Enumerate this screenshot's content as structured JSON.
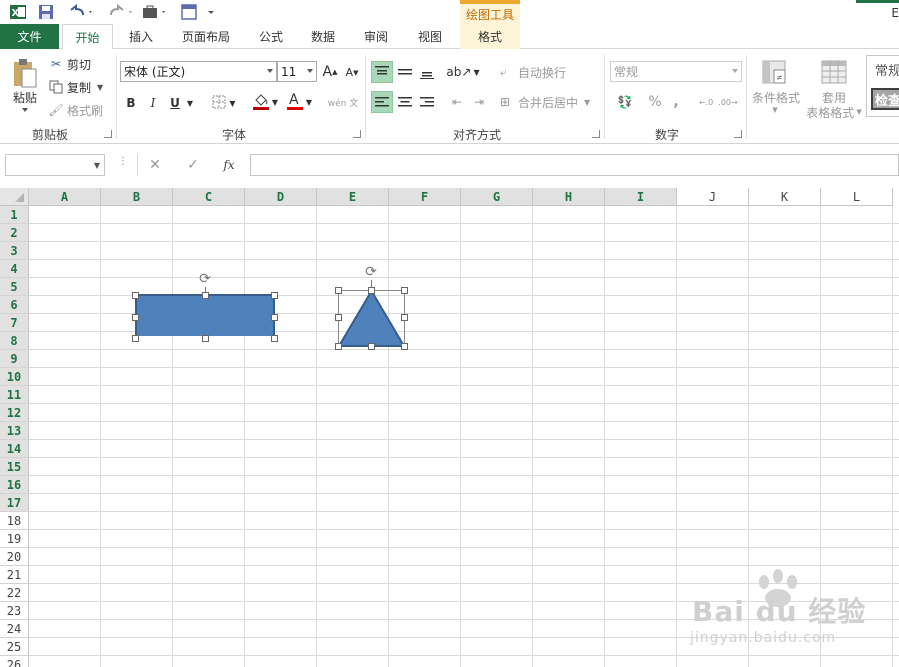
{
  "titlebar": {
    "contextual_header": "绘图工具",
    "title_edge_char": "E",
    "icons": [
      "excel-logo-icon",
      "save-icon",
      "undo-icon",
      "redo-icon",
      "briefcase-icon",
      "window-icon"
    ]
  },
  "tabs": {
    "file": "文件",
    "home": "开始",
    "insert": "插入",
    "page_layout": "页面布局",
    "formulas": "公式",
    "data": "数据",
    "review": "审阅",
    "view": "视图",
    "format": "格式"
  },
  "ribbon": {
    "clipboard": {
      "label": "剪贴板",
      "paste": "粘贴",
      "cut": "剪切",
      "copy": "复制",
      "format_painter": "格式刷"
    },
    "font": {
      "label": "字体",
      "font_name": "宋体 (正文)",
      "font_size": "11",
      "bold": "B",
      "italic": "I",
      "underline": "U",
      "grow": "A",
      "shrink": "A",
      "phonetic": "wén 文"
    },
    "alignment": {
      "label": "对齐方式",
      "wrap_text": "自动换行",
      "merge_center": "合并后居中"
    },
    "number": {
      "label": "数字",
      "format": "常规",
      "percent": "%",
      "comma": ","
    },
    "styles": {
      "conditional": "条件格式",
      "table_line1": "套用",
      "table_line2": "表格格式",
      "style_normal": "常规",
      "style_check": "检查"
    }
  },
  "formula_bar": {
    "fx": "fx",
    "cancel": "✕",
    "enter": "✓"
  },
  "columns": [
    "A",
    "B",
    "C",
    "D",
    "E",
    "F",
    "G",
    "H",
    "I",
    "J",
    "K",
    "L"
  ],
  "rows": [
    "1",
    "2",
    "3",
    "4",
    "5",
    "6",
    "7",
    "8",
    "9",
    "10",
    "11",
    "12",
    "13",
    "14",
    "15",
    "16",
    "17",
    "18",
    "19",
    "20",
    "21",
    "22",
    "23",
    "24",
    "25",
    "26"
  ],
  "selected_columns": 9,
  "selected_rows": 17,
  "shapes": {
    "rectangle_color": "#4f81bd",
    "triangle_color": "#4f81bd",
    "outline_color": "#385d8a"
  },
  "watermark": {
    "brand": "Bai du 经验",
    "url": "jingyan.baidu.com"
  },
  "colors": {
    "accent": "#217346",
    "contextual": "#f0a830"
  }
}
